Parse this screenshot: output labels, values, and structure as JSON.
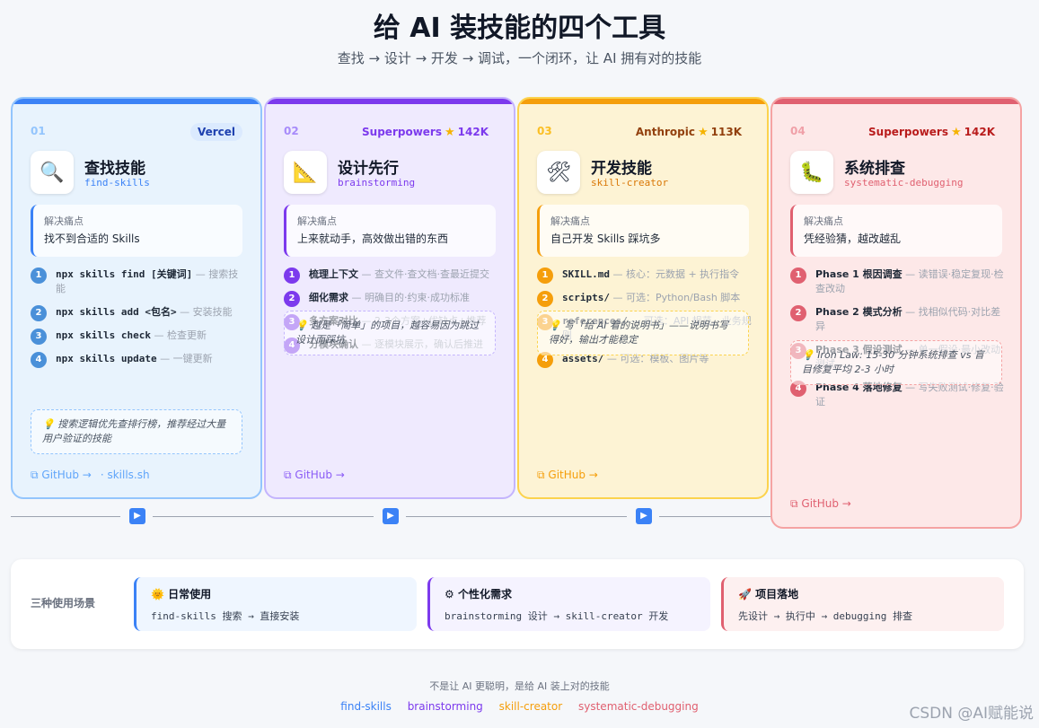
{
  "header": {
    "title": "给 AI 装技能的四个工具",
    "subtitle": "查找 → 设计 → 开发 → 调试，一个闭环，让 AI 拥有对的技能"
  },
  "colors": {
    "blue": "#3b82f6",
    "purple": "#7c3aed",
    "amber": "#f59e0b",
    "red": "#e06070"
  },
  "cards": [
    {
      "num": "01",
      "badge": "Vercel",
      "stars": "",
      "icon": "magnifier-icon",
      "icon_glyph": "🔍",
      "title": "查找技能",
      "slug": "find-skills",
      "pain_label": "解决痛点",
      "pain_text": "找不到合适的 Skills",
      "steps": [
        {
          "n": "1",
          "main": "npx skills find [关键词]",
          "desc": " — 搜索技能"
        },
        {
          "n": "2",
          "main": "npx skills add <包名>",
          "desc": " — 安装技能"
        },
        {
          "n": "3",
          "main": "npx skills check",
          "desc": " — 检查更新"
        },
        {
          "n": "4",
          "main": "npx skills update",
          "desc": " — 一键更新"
        }
      ],
      "tip": "💡 搜索逻辑优先查排行榜，推荐经过大量用户验证的技能",
      "github": "GitHub →",
      "extra_link": "· skills.sh"
    },
    {
      "num": "02",
      "badge": "Superpowers",
      "stars": "142K",
      "icon": "triangle-ruler-icon",
      "icon_glyph": "📐",
      "title": "设计先行",
      "slug": "brainstorming",
      "pain_label": "解决痛点",
      "pain_text": "上来就动手，高效做出错的东西",
      "steps": [
        {
          "n": "1",
          "main": "梳理上下文",
          "desc": " — 查文件·查文档·查最近提交"
        },
        {
          "n": "2",
          "main": "细化需求",
          "desc": " — 明确目的·约束·成功标准"
        },
        {
          "n": "3",
          "main": "多方案对比",
          "desc": " — 2-3个方案+优缺点+推荐"
        },
        {
          "n": "4",
          "main": "分模块确认",
          "desc": " — 逐模块展示，确认后推进"
        }
      ],
      "tip": "💡 越是「简单」的项目，越容易因为跳过设计而踩坑",
      "github": "GitHub →",
      "extra_link": ""
    },
    {
      "num": "03",
      "badge": "Anthropic",
      "stars": "113K",
      "icon": "hammer-wrench-icon",
      "icon_glyph": "🛠",
      "title": "开发技能",
      "slug": "skill-creator",
      "pain_label": "解决痛点",
      "pain_text": "自己开发 Skills 踩坑多",
      "steps": [
        {
          "n": "1",
          "main": "SKILL.md",
          "desc": " — 核心：元数据 + 执行指令"
        },
        {
          "n": "2",
          "main": "scripts/",
          "desc": " — 可选：Python/Bash 脚本"
        },
        {
          "n": "3",
          "main": "references/",
          "desc": " — 可选：API 规范、业务规则"
        },
        {
          "n": "4",
          "main": "assets/",
          "desc": " — 可选：模板、图片等"
        }
      ],
      "tip": "💡 写「给 AI 看的说明书」——说明书写得好，输出才能稳定",
      "github": "GitHub →",
      "extra_link": ""
    },
    {
      "num": "04",
      "badge": "Superpowers",
      "stars": "142K",
      "icon": "bug-icon",
      "icon_glyph": "🐛",
      "title": "系统排查",
      "slug": "systematic-debugging",
      "pain_label": "解决痛点",
      "pain_text": "凭经验猜，越改越乱",
      "steps": [
        {
          "n": "1",
          "main": "Phase 1 根因调查",
          "desc": " — 读错误·稳定复现·检查改动"
        },
        {
          "n": "2",
          "main": "Phase 2 模式分析",
          "desc": " — 找相似代码·对比差异"
        },
        {
          "n": "3",
          "main": "Phase 3 假设测试",
          "desc": " — 单一假设·最小改动测试"
        },
        {
          "n": "4",
          "main": "Phase 4 落地修复",
          "desc": " — 写失败测试·修复·验证"
        }
      ],
      "tip": "💡 Iron Law: 15-30 分钟系统排查 vs 盲目修复平均 2-3 小时",
      "github": "GitHub →",
      "extra_link": ""
    }
  ],
  "scenarios": {
    "label": "三种使用场景",
    "items": [
      {
        "icon": "sun-icon",
        "glyph": "🌞",
        "title": "日常使用",
        "desc": "find-skills 搜索 → 直接安装"
      },
      {
        "icon": "gear-icon",
        "glyph": "⚙",
        "title": "个性化需求",
        "desc": "brainstorming 设计 → skill-creator 开发"
      },
      {
        "icon": "rocket-icon",
        "glyph": "🚀",
        "title": "项目落地",
        "desc": "先设计 → 执行中 → debugging 排查"
      }
    ]
  },
  "footer": {
    "text": "不是让 AI 更聪明，是给 AI 装上对的技能",
    "links": [
      "find-skills",
      "brainstorming",
      "skill-creator",
      "systematic-debugging"
    ]
  },
  "watermark": "CSDN @AI赋能说"
}
